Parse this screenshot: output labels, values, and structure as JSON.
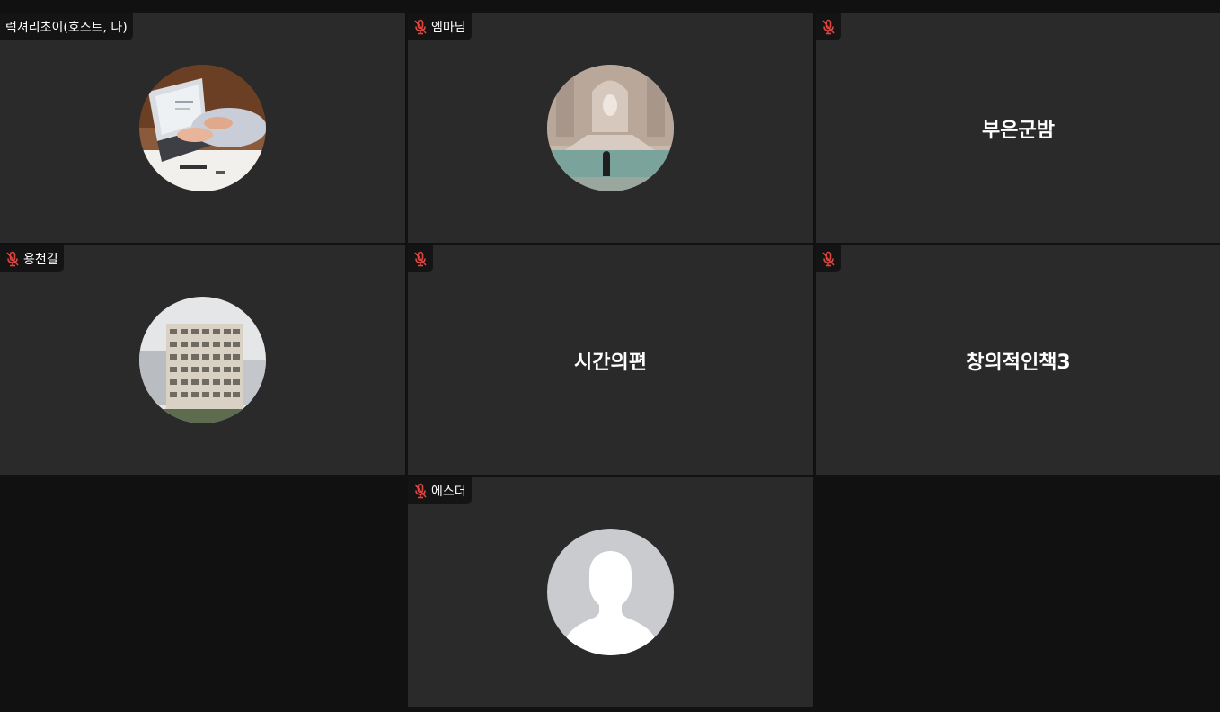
{
  "participants": [
    {
      "tag_label": "럭셔리초이(호스트, 나)",
      "muted": false,
      "avatar": "laptop-photo"
    },
    {
      "tag_label": "엠마님",
      "muted": true,
      "avatar": "fountain-photo"
    },
    {
      "tag_label": "",
      "muted": true,
      "display_name": "부은군밤"
    },
    {
      "tag_label": "용천길",
      "muted": true,
      "avatar": "building-photo"
    },
    {
      "tag_label": "",
      "muted": true,
      "display_name": "시간의편"
    },
    {
      "tag_label": "",
      "muted": true,
      "display_name": "창의적인책3"
    },
    {
      "tag_label": "에스더",
      "muted": true,
      "avatar": "default-user-silhouette"
    }
  ],
  "colors": {
    "background": "#111111",
    "tile": "#2a2a2a",
    "muted_mic": "#e0443e",
    "text": "#ffffff"
  },
  "icons": {
    "muted": "mic-off-icon"
  }
}
